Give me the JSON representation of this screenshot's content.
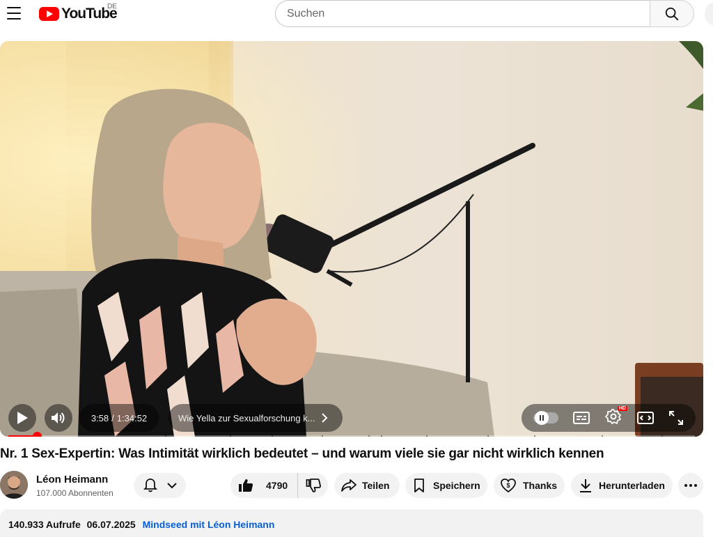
{
  "header": {
    "logo_text": "YouTube",
    "country_code": "DE",
    "search_placeholder": "Suchen"
  },
  "player": {
    "time_current": "3:58",
    "time_total": "1:34:52",
    "time_separator": "/",
    "chapter_title": "Wie Yella zur Sexualforschung k...",
    "progress_fraction": 0.042,
    "hd_badge": "HD"
  },
  "video": {
    "title": "Nr. 1 Sex-Expertin: Was Intimität wirklich bedeutet – und warum viele sie gar nicht wirklich kennen"
  },
  "channel": {
    "name": "Léon Heimann",
    "subscribers": "107.000 Abonnenten"
  },
  "actions": {
    "like_count": "4790",
    "share_label": "Teilen",
    "save_label": "Speichern",
    "thanks_label": "Thanks",
    "download_label": "Herunterladen"
  },
  "description": {
    "views": "140.933 Aufrufe",
    "date": "06.07.2025",
    "tag": "Mindseed mit Léon Heimann"
  },
  "colors": {
    "brand_red": "#ff0000",
    "link_blue": "#065fd4",
    "pill_bg": "#f2f2f2"
  }
}
